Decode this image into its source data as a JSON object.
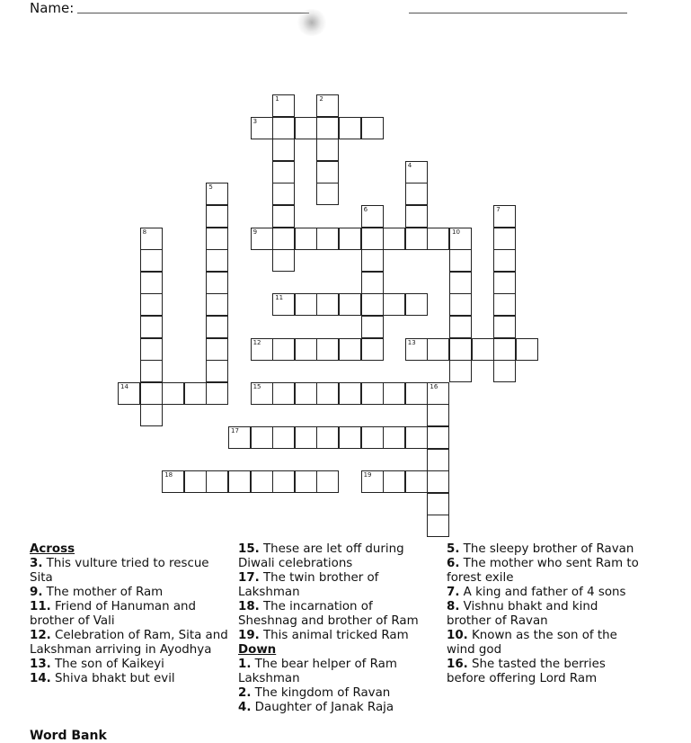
{
  "header": {
    "name_label": "Name:"
  },
  "puzzle": {
    "numbers": [
      {
        "n": "1",
        "r": 0,
        "c": 7
      },
      {
        "n": "2",
        "r": 0,
        "c": 9
      },
      {
        "n": "3",
        "r": 1,
        "c": 6
      },
      {
        "n": "4",
        "r": 3,
        "c": 13
      },
      {
        "n": "5",
        "r": 4,
        "c": 4
      },
      {
        "n": "6",
        "r": 5,
        "c": 11
      },
      {
        "n": "7",
        "r": 5,
        "c": 17
      },
      {
        "n": "8",
        "r": 6,
        "c": 1
      },
      {
        "n": "9",
        "r": 6,
        "c": 6
      },
      {
        "n": "10",
        "r": 6,
        "c": 15
      },
      {
        "n": "11",
        "r": 9,
        "c": 7
      },
      {
        "n": "12",
        "r": 11,
        "c": 6
      },
      {
        "n": "13",
        "r": 11,
        "c": 13
      },
      {
        "n": "14",
        "r": 13,
        "c": 0
      },
      {
        "n": "15",
        "r": 13,
        "c": 6
      },
      {
        "n": "16",
        "r": 13,
        "c": 14
      },
      {
        "n": "17",
        "r": 15,
        "c": 5
      },
      {
        "n": "18",
        "r": 17,
        "c": 2
      },
      {
        "n": "19",
        "r": 17,
        "c": 11
      }
    ]
  },
  "clues": {
    "across_heading": "Across",
    "across": [
      {
        "num": "3.",
        "text": "This vulture tried to rescue Sita"
      },
      {
        "num": "9.",
        "text": "The mother of Ram"
      },
      {
        "num": "11.",
        "text": "Friend of Hanuman and brother of Vali"
      },
      {
        "num": "12.",
        "text": "Celebration of Ram, Sita and Lakshman arriving in Ayodhya"
      },
      {
        "num": "13.",
        "text": "The son of Kaikeyi"
      },
      {
        "num": "14.",
        "text": "Shiva bhakt but evil"
      },
      {
        "num": "15.",
        "text": "These are let off during Diwali celebrations"
      },
      {
        "num": "17.",
        "text": "The twin brother of Lakshman"
      },
      {
        "num": "18.",
        "text": "The incarnation of Sheshnag and brother of Ram"
      },
      {
        "num": "19.",
        "text": "This animal tricked Ram"
      }
    ],
    "down_heading": "Down",
    "down": [
      {
        "num": "1.",
        "text": "The bear helper of Ram Lakshman"
      },
      {
        "num": "2.",
        "text": "The kingdom of Ravan"
      },
      {
        "num": "4.",
        "text": "Daughter of Janak Raja"
      },
      {
        "num": "5.",
        "text": "The sleepy brother of Ravan"
      },
      {
        "num": "6.",
        "text": "The mother who sent Ram to forest exile"
      },
      {
        "num": "7.",
        "text": "A king and father of 4 sons"
      },
      {
        "num": "8.",
        "text": "Vishnu bhakt and kind brother of Ravan"
      },
      {
        "num": "10.",
        "text": "Known as the son of the wind god"
      },
      {
        "num": "16.",
        "text": "She tasted the berries before offering Lord Ram"
      }
    ]
  },
  "word_bank_heading": "Word Bank"
}
